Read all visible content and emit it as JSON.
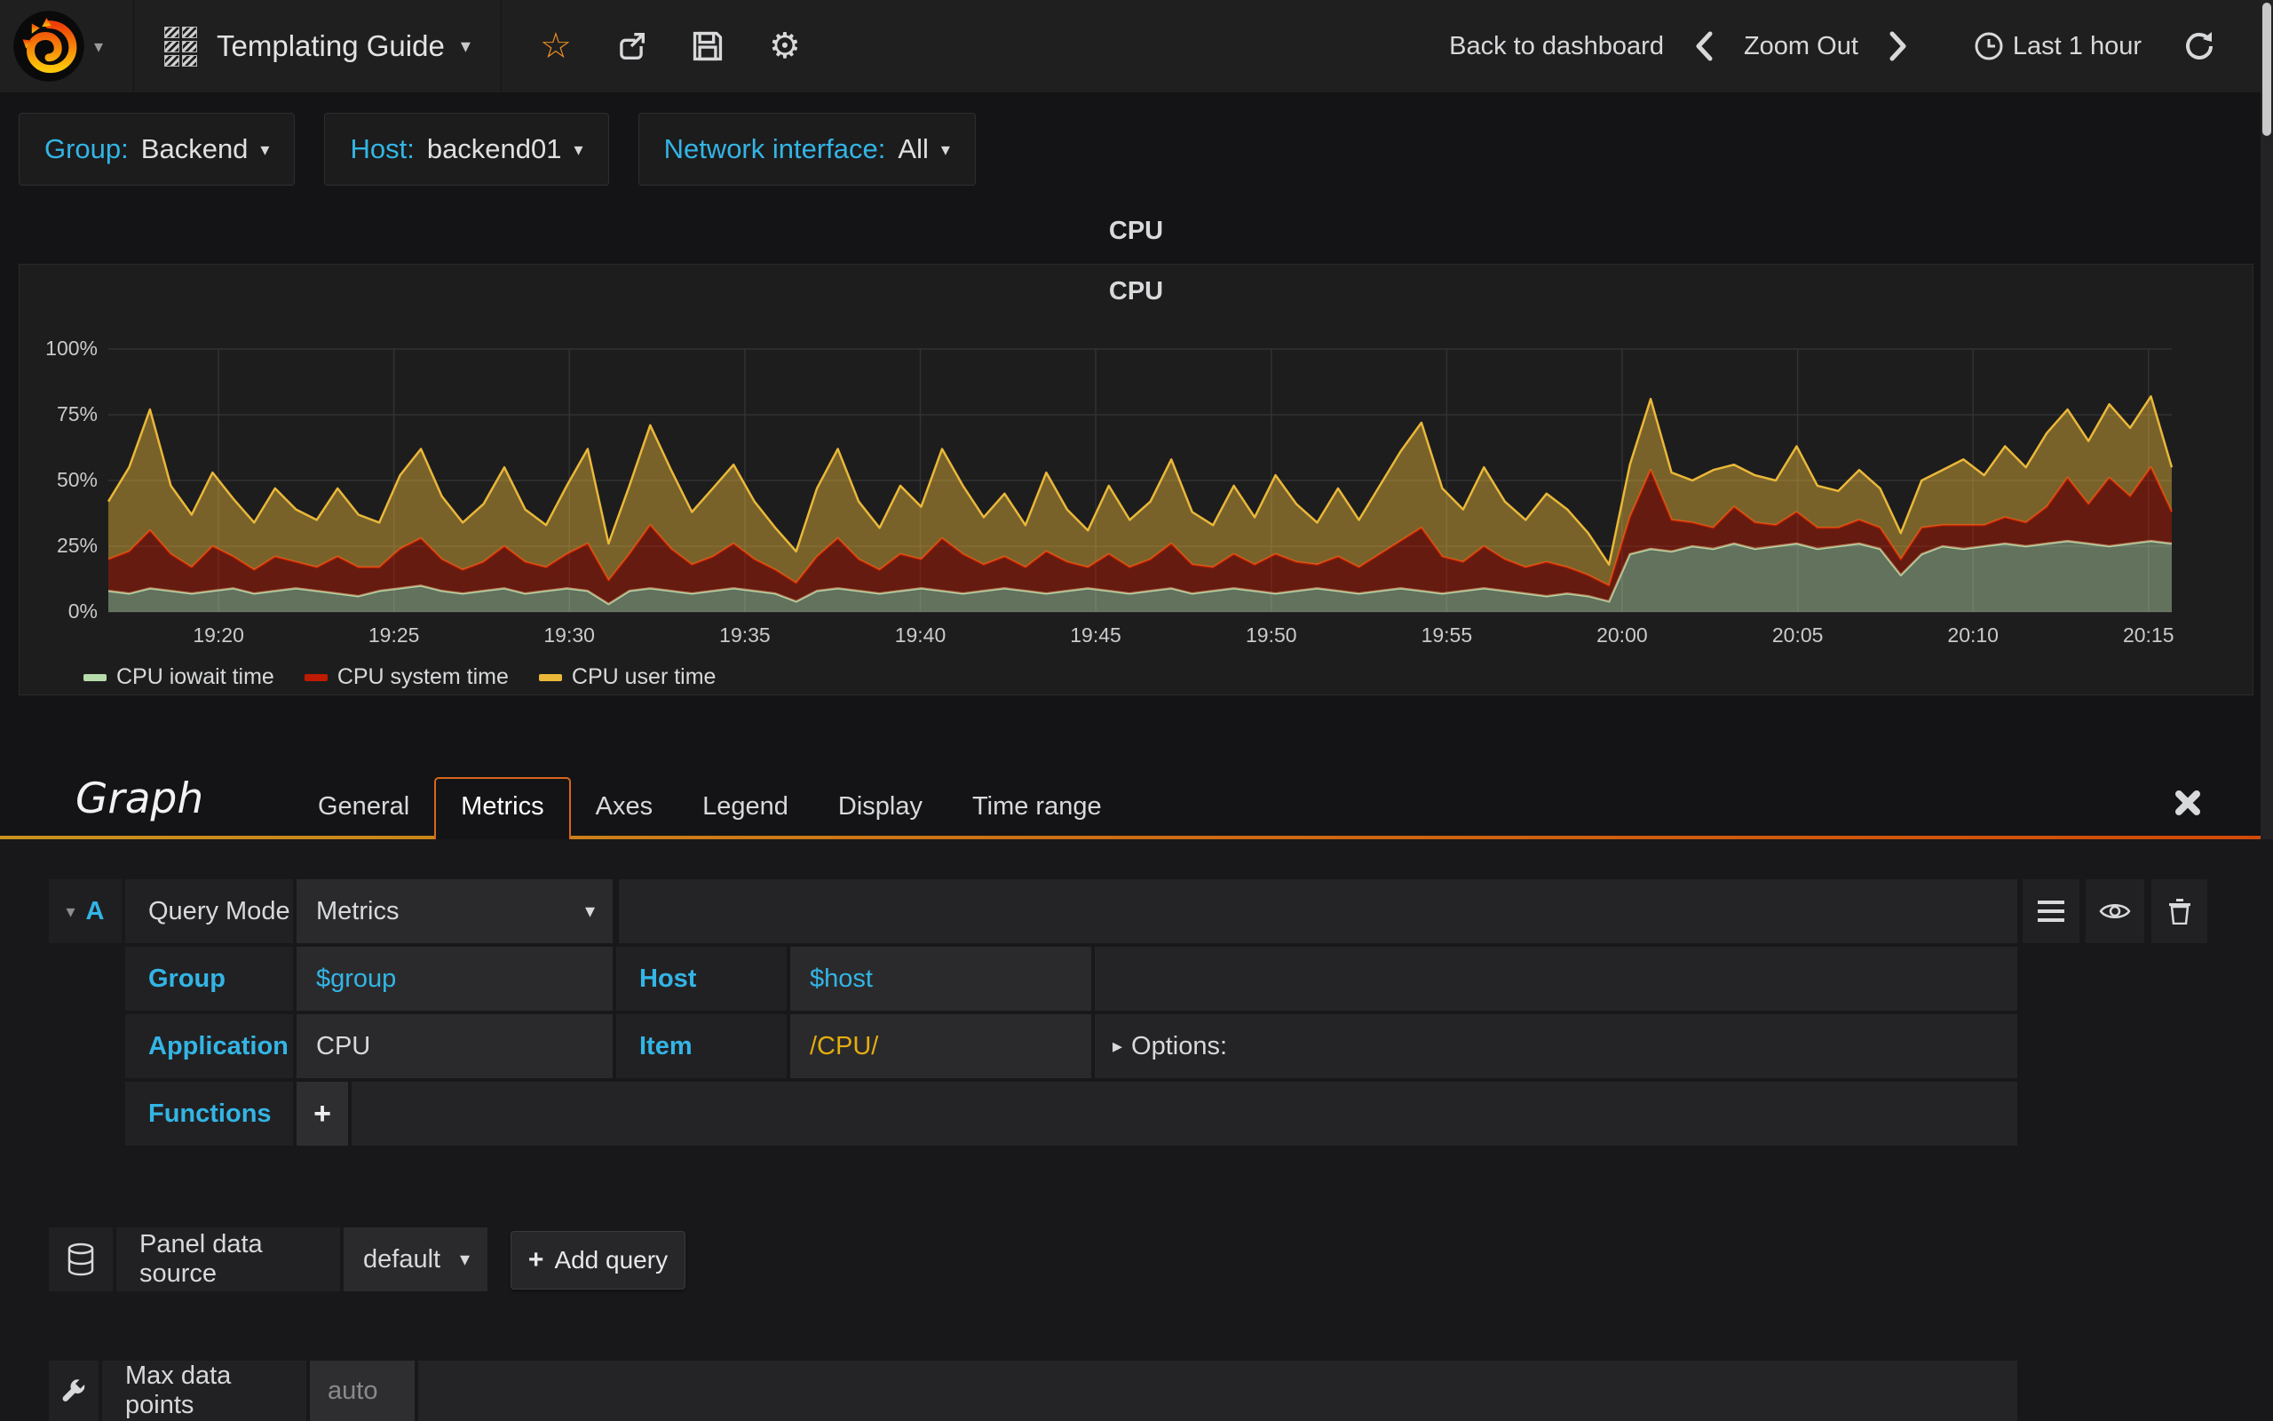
{
  "navbar": {
    "dashboard_title": "Templating Guide",
    "actions": [
      "star-icon",
      "share-icon",
      "save-icon",
      "settings-icon"
    ],
    "back_to_dashboard": "Back to dashboard",
    "zoom_out": "Zoom Out",
    "time_range": "Last 1 hour"
  },
  "variables": [
    {
      "label": "Group:",
      "value": "Backend"
    },
    {
      "label": "Host:",
      "value": "backend01"
    },
    {
      "label": "Network interface:",
      "value": "All"
    }
  ],
  "panel": {
    "header_title": "CPU",
    "inner_title": "CPU"
  },
  "chart_data": {
    "type": "area",
    "stacked": true,
    "title": "CPU",
    "ylabel": "percent",
    "ylim": [
      0,
      100
    ],
    "grid": true,
    "legend_position": "bottom-left",
    "yticks": [
      {
        "label": "0%",
        "v": 0
      },
      {
        "label": "25%",
        "v": 25
      },
      {
        "label": "50%",
        "v": 50
      },
      {
        "label": "75%",
        "v": 75
      },
      {
        "label": "100%",
        "v": 100
      }
    ],
    "xticks": [
      {
        "label": "19:20",
        "f": 0.0534
      },
      {
        "label": "19:25",
        "f": 0.1384
      },
      {
        "label": "19:30",
        "f": 0.2234
      },
      {
        "label": "19:35",
        "f": 0.3085
      },
      {
        "label": "19:40",
        "f": 0.3935
      },
      {
        "label": "19:45",
        "f": 0.4785
      },
      {
        "label": "19:50",
        "f": 0.5636
      },
      {
        "label": "19:55",
        "f": 0.6486
      },
      {
        "label": "20:00",
        "f": 0.7336
      },
      {
        "label": "20:05",
        "f": 0.8187
      },
      {
        "label": "20:10",
        "f": 0.9037
      },
      {
        "label": "20:15",
        "f": 0.9887
      }
    ],
    "x_range": [
      "19:17",
      "20:16"
    ],
    "series": [
      {
        "name": "CPU iowait time",
        "color": "#B7DBAB",
        "values": [
          8,
          7,
          9,
          8,
          7,
          8,
          9,
          7,
          8,
          9,
          8,
          7,
          6,
          8,
          9,
          10,
          8,
          7,
          8,
          9,
          7,
          8,
          9,
          8,
          3,
          8,
          9,
          8,
          7,
          8,
          9,
          8,
          7,
          4,
          8,
          9,
          8,
          7,
          8,
          9,
          8,
          7,
          8,
          9,
          8,
          7,
          8,
          9,
          8,
          7,
          8,
          9,
          7,
          8,
          9,
          8,
          7,
          8,
          9,
          8,
          7,
          8,
          9,
          8,
          7,
          8,
          9,
          8,
          7,
          6,
          7,
          6,
          4,
          22,
          24,
          23,
          25,
          24,
          26,
          24,
          25,
          26,
          24,
          25,
          26,
          24,
          14,
          22,
          25,
          24,
          25,
          26,
          25,
          26,
          27,
          26,
          25,
          26,
          27,
          26
        ]
      },
      {
        "name": "CPU system time",
        "color": "#BF1B00",
        "values": [
          12,
          16,
          22,
          14,
          10,
          17,
          12,
          9,
          13,
          10,
          9,
          14,
          11,
          9,
          15,
          18,
          12,
          9,
          11,
          16,
          12,
          9,
          13,
          18,
          9,
          14,
          24,
          16,
          11,
          13,
          17,
          12,
          9,
          7,
          13,
          19,
          12,
          9,
          14,
          11,
          20,
          15,
          10,
          12,
          9,
          16,
          11,
          8,
          14,
          10,
          12,
          17,
          11,
          9,
          13,
          10,
          15,
          11,
          9,
          13,
          10,
          14,
          18,
          24,
          14,
          11,
          16,
          12,
          10,
          13,
          10,
          8,
          6,
          14,
          30,
          12,
          9,
          8,
          14,
          10,
          8,
          12,
          8,
          7,
          9,
          8,
          6,
          10,
          8,
          9,
          8,
          10,
          9,
          14,
          24,
          15,
          26,
          18,
          28,
          12
        ]
      },
      {
        "name": "CPU user time",
        "color": "#EAB839",
        "values": [
          22,
          32,
          46,
          26,
          20,
          28,
          22,
          18,
          26,
          20,
          18,
          26,
          20,
          17,
          28,
          34,
          24,
          18,
          22,
          30,
          20,
          16,
          26,
          36,
          14,
          26,
          38,
          30,
          20,
          26,
          30,
          22,
          16,
          12,
          26,
          34,
          22,
          16,
          26,
          20,
          34,
          26,
          18,
          24,
          16,
          30,
          20,
          14,
          26,
          18,
          22,
          32,
          20,
          16,
          26,
          18,
          30,
          22,
          16,
          26,
          18,
          26,
          34,
          40,
          26,
          20,
          30,
          22,
          18,
          26,
          22,
          16,
          8,
          20,
          27,
          18,
          16,
          22,
          16,
          18,
          17,
          25,
          16,
          14,
          19,
          15,
          10,
          18,
          21,
          25,
          19,
          27,
          21,
          28,
          26,
          24,
          28,
          26,
          27,
          17
        ]
      }
    ]
  },
  "editor": {
    "panel_type": "Graph",
    "tabs": [
      {
        "label": "General",
        "active": false
      },
      {
        "label": "Metrics",
        "active": true
      },
      {
        "label": "Axes",
        "active": false
      },
      {
        "label": "Legend",
        "active": false
      },
      {
        "label": "Display",
        "active": false
      },
      {
        "label": "Time range",
        "active": false
      }
    ],
    "query": {
      "letter": "A",
      "query_mode_label": "Query Mode",
      "query_mode_value": "Metrics",
      "group_label": "Group",
      "group_value": "$group",
      "host_label": "Host",
      "host_value": "$host",
      "application_label": "Application",
      "application_value": "CPU",
      "item_label": "Item",
      "item_value": "/CPU/",
      "options_label": "Options:",
      "functions_label": "Functions",
      "add_function": "+"
    },
    "datasource": {
      "label": "Panel data source",
      "value": "default",
      "add_query": "Add query"
    },
    "max_data_points": {
      "label": "Max data points",
      "placeholder": "auto"
    }
  }
}
